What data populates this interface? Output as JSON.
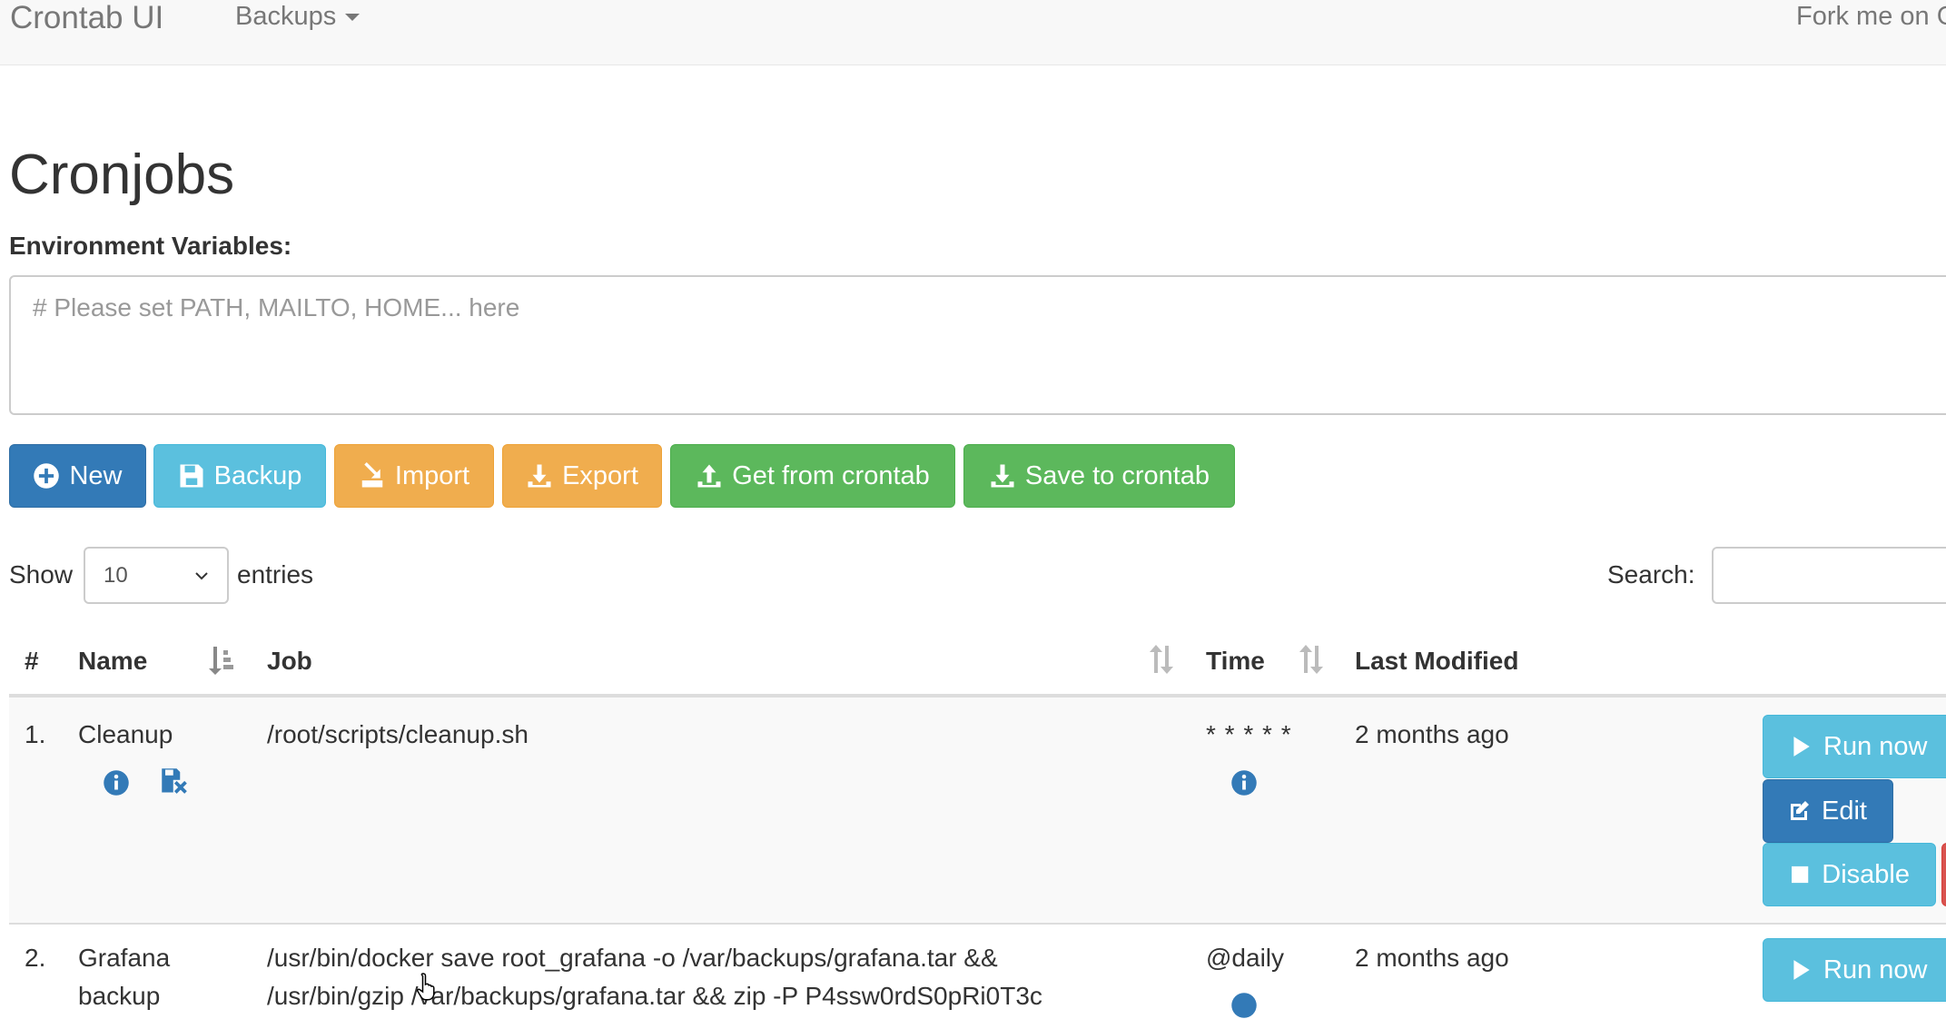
{
  "navbar": {
    "brand": "Crontab UI",
    "backups_menu": "Backups",
    "fork_link": "Fork me on G"
  },
  "page": {
    "title": "Cronjobs",
    "env_label": "Environment Variables:",
    "env_placeholder": "# Please set PATH, MAILTO, HOME... here",
    "env_value": ""
  },
  "toolbar": {
    "new_label": "New",
    "backup_label": "Backup",
    "import_label": "Import",
    "export_label": "Export",
    "get_label": "Get from crontab",
    "save_label": "Save to crontab"
  },
  "table_controls": {
    "show_label": "Show",
    "page_length": "10",
    "entries_label": "entries",
    "search_label": "Search:",
    "search_value": ""
  },
  "table": {
    "columns": [
      "#",
      "Name",
      "Job",
      "Time",
      "Last Modified"
    ],
    "rows": [
      {
        "index": "1.",
        "name_line1": "Cleanup",
        "name_line2": "",
        "job_line1": "/root/scripts/cleanup.sh",
        "job_line2": "",
        "time": "* * * * *",
        "last_modified": "2 months ago"
      },
      {
        "index": "2.",
        "name_line1": "Grafana",
        "name_line2": "backup",
        "job_line1": "/usr/bin/docker save root_grafana -o /var/backups/grafana.tar &&",
        "job_line2": "/usr/bin/gzip /var/backups/grafana.tar && zip -P P4ssw0rdS0pRi0T3c",
        "time": "@daily",
        "last_modified": "2 months ago"
      }
    ],
    "actions": {
      "run_label": "Run now",
      "edit_label": "Edit",
      "disable_label": "Disable"
    }
  },
  "colors": {
    "primary": "#337ab7",
    "info": "#5bc0de",
    "warning": "#f0ad4e",
    "success": "#5cb85c",
    "navbar_bg": "#f8f8f8"
  },
  "icons": [
    "plus-circle-icon",
    "backup-floppy-icon",
    "import-icon",
    "download-icon",
    "upload-icon",
    "info-icon",
    "floppy-remove-icon",
    "sort-icon",
    "play-icon",
    "edit-icon",
    "stop-icon",
    "hand-cursor-icon"
  ]
}
